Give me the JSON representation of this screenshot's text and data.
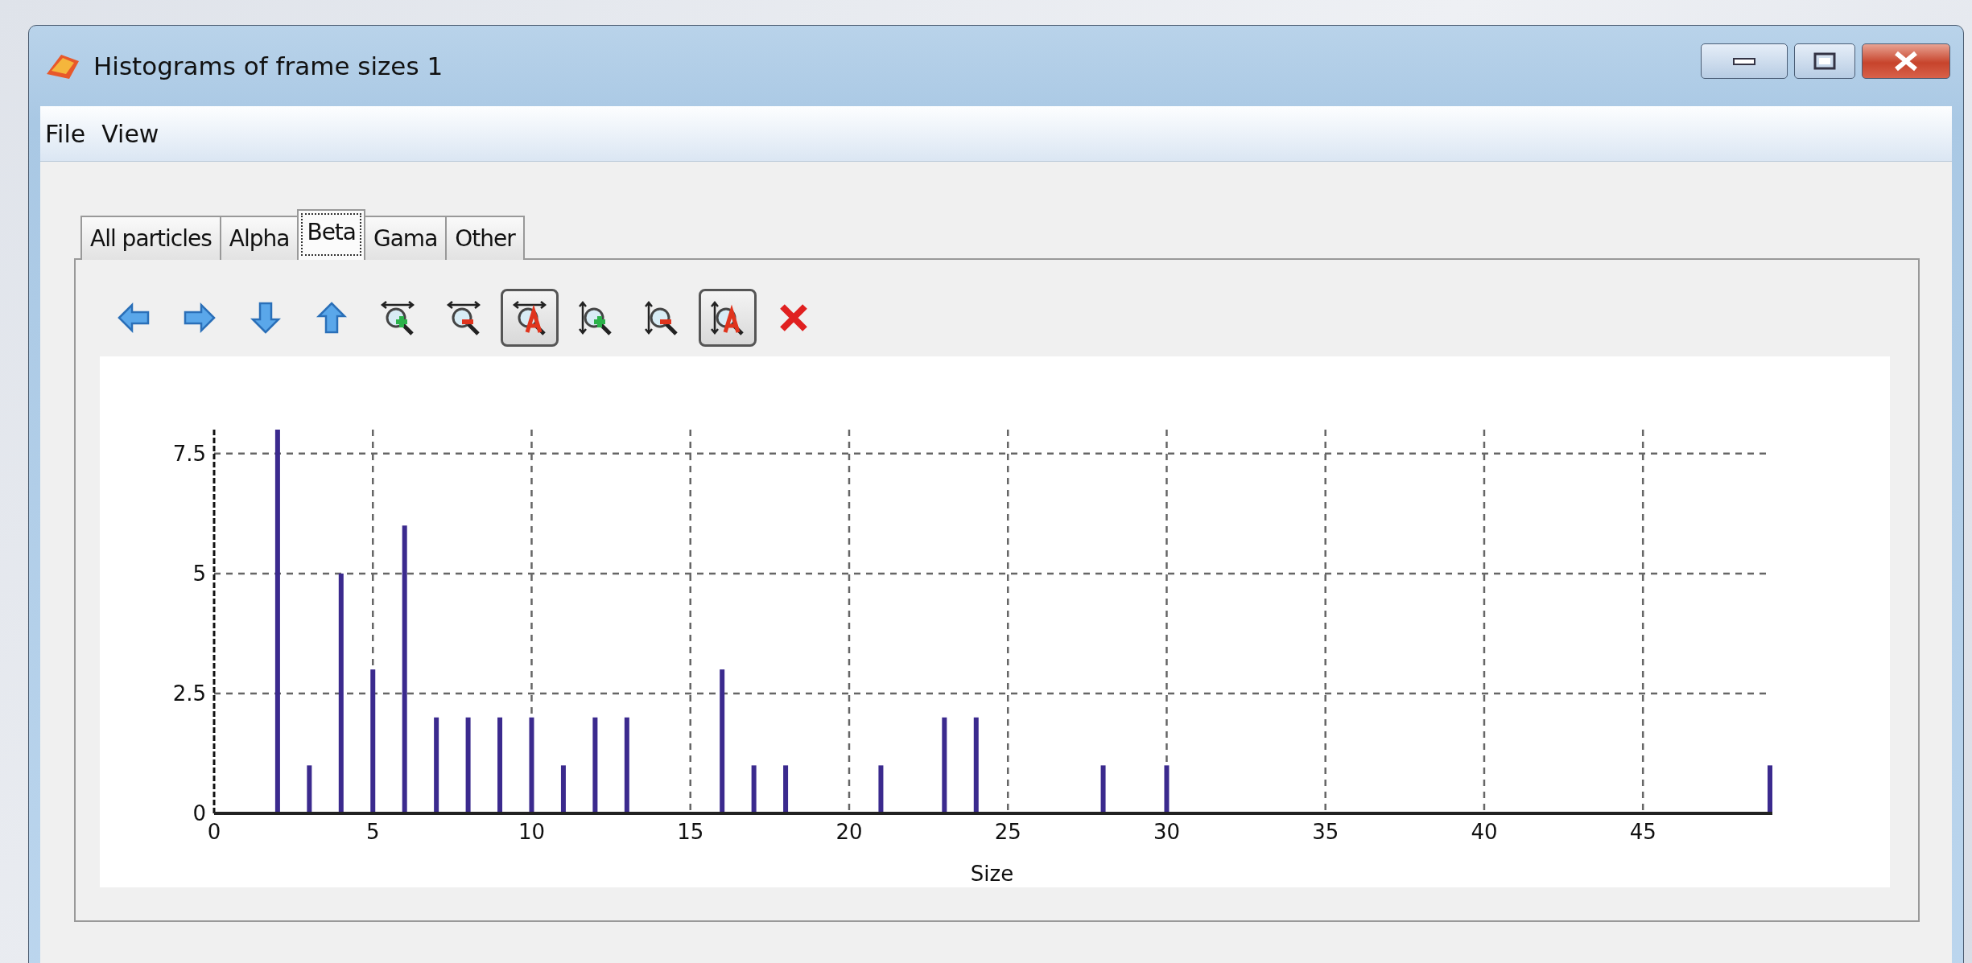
{
  "window": {
    "title": "Histograms of frame sizes 1"
  },
  "menu": [
    "File",
    "View"
  ],
  "tabs": [
    {
      "label": "All particles",
      "selected": false
    },
    {
      "label": "Alpha",
      "selected": false
    },
    {
      "label": "Beta",
      "selected": true
    },
    {
      "label": "Gama",
      "selected": false
    },
    {
      "label": "Other",
      "selected": false
    }
  ],
  "toolbar": [
    {
      "kind": "left",
      "checked": false
    },
    {
      "kind": "right",
      "checked": false
    },
    {
      "kind": "down",
      "checked": false
    },
    {
      "kind": "up",
      "checked": false
    },
    {
      "kind": "zoom-in-x",
      "checked": false
    },
    {
      "kind": "zoom-out-x",
      "checked": false
    },
    {
      "kind": "auto-x",
      "checked": true
    },
    {
      "kind": "zoom-in-y",
      "checked": false
    },
    {
      "kind": "zoom-out-y",
      "checked": false
    },
    {
      "kind": "auto-y",
      "checked": true
    },
    {
      "kind": "close",
      "checked": false
    }
  ],
  "chart_data": {
    "type": "bar",
    "xlabel": "Size",
    "x": [
      2,
      3,
      4,
      5,
      6,
      7,
      8,
      9,
      10,
      11,
      12,
      13,
      16,
      17,
      18,
      21,
      23,
      24,
      28,
      30,
      49
    ],
    "grid": true,
    "series": [
      {
        "color": "#3b2a8e",
        "values": [
          8,
          1,
          5,
          3,
          6,
          2,
          2,
          2,
          2,
          1,
          2,
          2,
          3,
          1,
          1,
          1,
          2,
          2,
          1,
          1,
          1
        ]
      }
    ],
    "xlim": [
      0,
      49
    ],
    "ylim": [
      0,
      8
    ],
    "xticks": [
      0,
      5,
      10,
      15,
      20,
      25,
      30,
      35,
      40,
      45
    ],
    "yticks": [
      0,
      {
        "value": 2.5,
        "label": "2.5"
      },
      5,
      {
        "value": 7.5,
        "label": "7.5"
      }
    ]
  }
}
